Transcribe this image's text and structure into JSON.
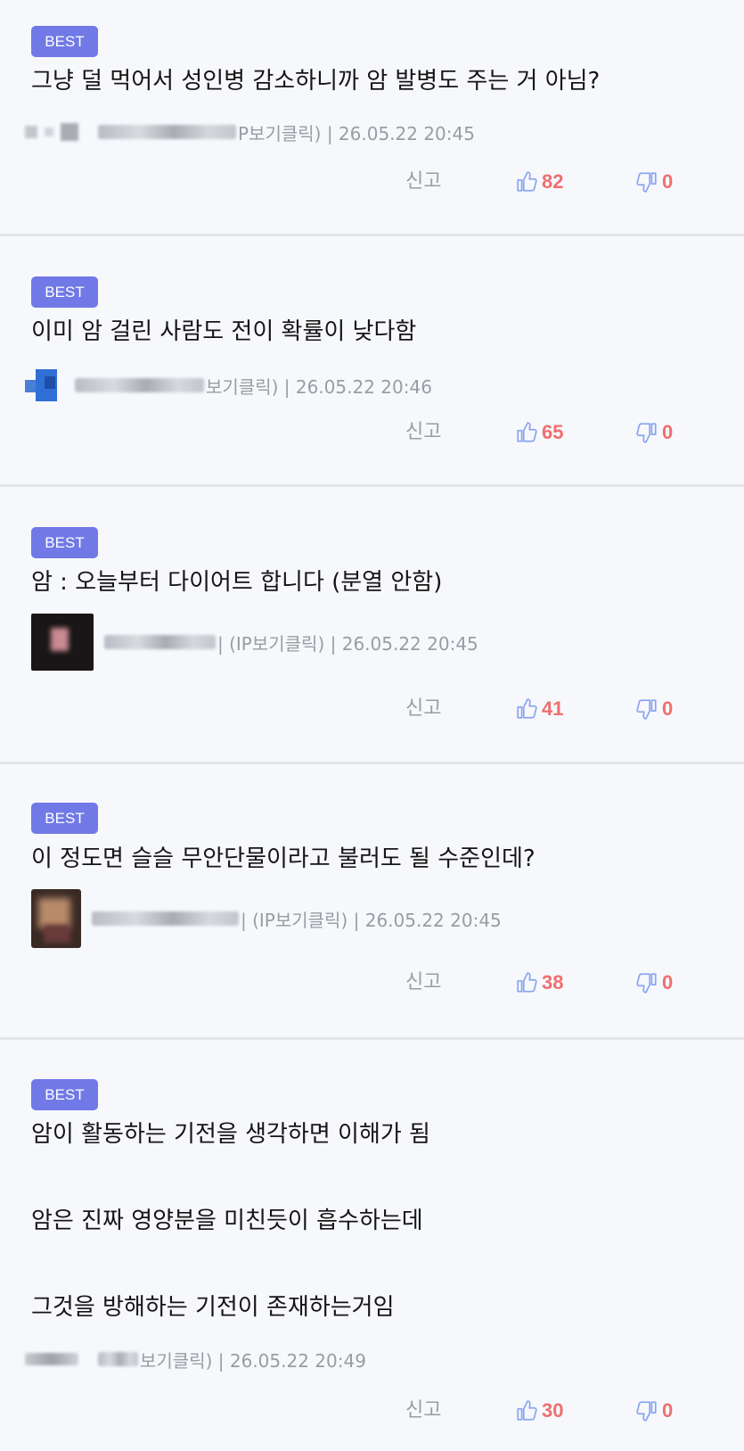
{
  "badge_label": "BEST",
  "report_label": "신고",
  "icons": {
    "like": "thumbs-up-icon",
    "dislike": "thumbs-down-icon"
  },
  "colors": {
    "badge": "#7079e6",
    "count": "#ef6f6f",
    "thumb": "#8aa6f0"
  },
  "comments": [
    {
      "lines": [
        "그냥 덜 먹어서 성인병 감소하니까 암 발병도 주는 거 아님?"
      ],
      "meta": "P보기클릭) | 26.05.22 20:45",
      "likes": "82",
      "dislikes": "0"
    },
    {
      "lines": [
        "이미 암 걸린 사람도 전이 확률이 낮다함"
      ],
      "meta": "보기클릭) | 26.05.22 20:46",
      "likes": "65",
      "dislikes": "0"
    },
    {
      "lines": [
        "암 : 오늘부터 다이어트 합니다 (분열 안함)"
      ],
      "meta": "| (IP보기클릭) | 26.05.22 20:45",
      "likes": "41",
      "dislikes": "0"
    },
    {
      "lines": [
        "이 정도면 슬슬 무안단물이라고 불러도 될 수준인데?"
      ],
      "meta": "| (IP보기클릭) | 26.05.22 20:45",
      "likes": "38",
      "dislikes": "0"
    },
    {
      "lines": [
        "암이 활동하는 기전을 생각하면 이해가 됨",
        "암은 진짜 영양분을 미친듯이 흡수하는데",
        "그것을 방해하는 기전이 존재하는거임"
      ],
      "meta": "보기클릭) | 26.05.22 20:49",
      "likes": "30",
      "dislikes": "0"
    }
  ]
}
